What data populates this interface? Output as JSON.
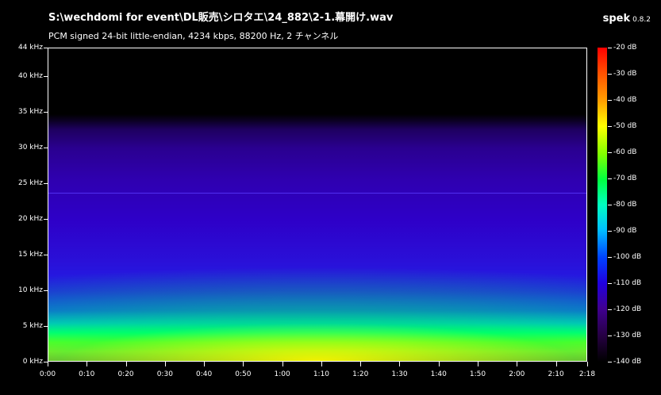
{
  "header": {
    "file_path": "S:\\wechdomi for event\\DL販売\\シロタエ\\24_882\\2-1.幕開け.wav",
    "audio_info": "PCM signed 24-bit little-endian, 4234 kbps, 88200 Hz, 2 チャンネル",
    "app_name": "spek",
    "app_version": "0.8.2"
  },
  "frequency_axis": {
    "labels": [
      "44 kHz",
      "40 kHz",
      "35 kHz",
      "30 kHz",
      "25 kHz",
      "20 kHz",
      "15 kHz",
      "10 kHz",
      "5 kHz",
      "0 kHz"
    ]
  },
  "time_axis": {
    "labels": [
      "0:00",
      "0:10",
      "0:20",
      "0:30",
      "0:40",
      "0:50",
      "1:00",
      "1:10",
      "1:20",
      "1:30",
      "1:40",
      "1:50",
      "2:00",
      "2:10",
      "2:18"
    ]
  },
  "colorbar": {
    "labels": [
      "-20 dB",
      "-30 dB",
      "-40 dB",
      "-50 dB",
      "-60 dB",
      "-70 dB",
      "-80 dB",
      "-90 dB",
      "-100 dB",
      "-110 dB",
      "-120 dB",
      "-130 dB",
      "-140 dB"
    ]
  },
  "colors": {
    "background": "#000000",
    "text": "#ffffff",
    "accent_line": "#5a3cff"
  }
}
